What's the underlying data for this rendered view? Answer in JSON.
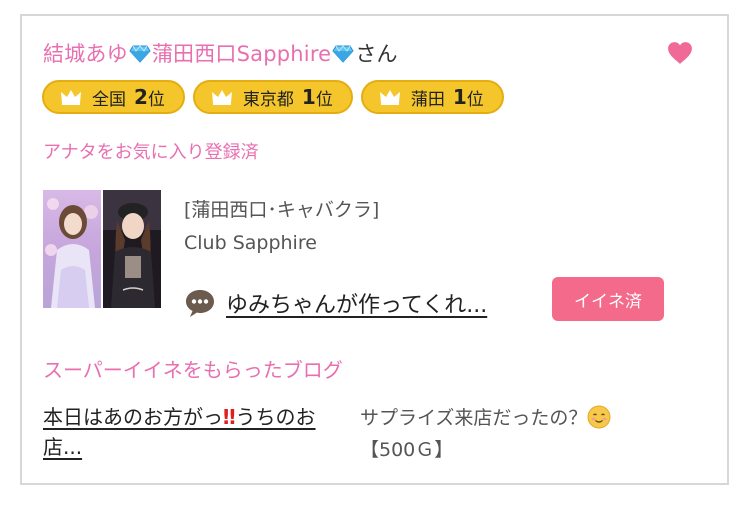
{
  "cast": {
    "name_part1": "結城あゆ",
    "name_part2": "蒲田西口Sapphire",
    "suffix": "さん",
    "gem_icon": "diamond-icon",
    "heart_icon": "heart-icon"
  },
  "rankings": [
    {
      "area": "全国",
      "rank": "2",
      "unit": "位"
    },
    {
      "area": "東京都",
      "rank": "1",
      "unit": "位"
    },
    {
      "area": "蒲田",
      "rank": "1",
      "unit": "位"
    }
  ],
  "favorite_status": "アナタをお気に入り登録済",
  "shop": {
    "area_category": "[蒲田西口･キャバクラ]",
    "name": "Club Sapphire"
  },
  "blog": {
    "title": "ゆみちゃんが作ってくれ...",
    "like_label": "イイネ済"
  },
  "super_like": {
    "section_title": "スーパーイイネをもらったブログ",
    "post_title_part1": "本日はあのお方がっ",
    "post_title_excl": "‼",
    "post_title_part2": "うちのお店...",
    "description": "サプライズ来店だったの？",
    "points": "【500Ｇ】"
  },
  "colors": {
    "accent_pink": "#e86fb0",
    "badge_gold": "#f5c62b",
    "like_button": "#f46a8a"
  }
}
